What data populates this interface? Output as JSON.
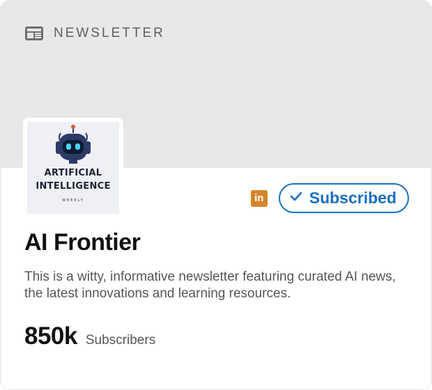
{
  "banner": {
    "label": "NEWSLETTER",
    "icon": "newspaper-icon"
  },
  "logo": {
    "icon": "robot-icon",
    "line1": "ARTIFICIAL",
    "line2": "INTELLIGENCE",
    "line3": "WEEKLY"
  },
  "actions": {
    "linkedin_icon": "linkedin-icon",
    "linkedin_text": "in",
    "subscribe_label": "Subscribed",
    "subscribe_icon": "check-icon"
  },
  "newsletter": {
    "title": "AI Frontier",
    "description": "This is a witty, informative newsletter featuring curated AI news, the latest innovations and learning resources.",
    "subscriber_count": "850k",
    "subscriber_label": "Subscribers"
  },
  "colors": {
    "banner_bg": "#e8e8e8",
    "accent_blue": "#1a6fc0",
    "linkedin_orange": "#d5852a",
    "robot_navy": "#2c3a66",
    "robot_eye": "#4fd2ff"
  }
}
